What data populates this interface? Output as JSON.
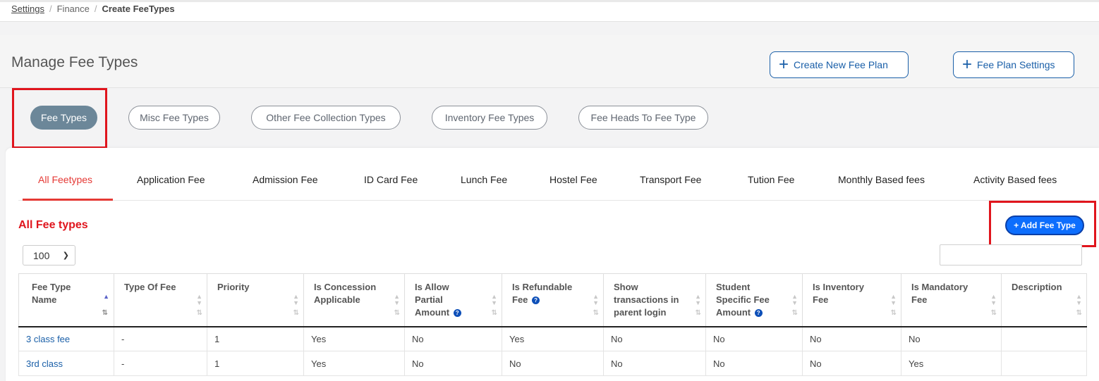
{
  "breadcrumb": {
    "link": "Settings",
    "middle": "Finance",
    "current": "Create FeeTypes"
  },
  "page_title": "Manage Fee Types",
  "header_buttons": {
    "create_plan": "Create New Fee Plan",
    "plan_settings": "Fee Plan Settings"
  },
  "pills": [
    "Fee Types",
    "Misc Fee Types",
    "Other Fee Collection Types",
    "Inventory Fee Types",
    "Fee Heads To Fee Type"
  ],
  "tabs": [
    "All Feetypes",
    "Application Fee",
    "Admission Fee",
    "ID Card Fee",
    "Lunch Fee",
    "Hostel Fee",
    "Transport Fee",
    "Tution Fee",
    "Monthly Based fees",
    "Activity Based fees"
  ],
  "section_title": "All Fee types",
  "add_button": "+ Add Fee Type",
  "page_size": "100",
  "search": {
    "value": "",
    "placeholder": ""
  },
  "table": {
    "headers": [
      {
        "l1": "Fee Type",
        "l2": "Name",
        "l3": ""
      },
      {
        "l1": "Type Of Fee",
        "l2": "",
        "l3": ""
      },
      {
        "l1": "Priority",
        "l2": "",
        "l3": ""
      },
      {
        "l1": "Is Concession",
        "l2": "Applicable",
        "l3": ""
      },
      {
        "l1": "Is Allow",
        "l2": "Partial",
        "l3": "Amount"
      },
      {
        "l1": "Is Refundable",
        "l2": "Fee",
        "l3": ""
      },
      {
        "l1": "Show",
        "l2": "transactions in",
        "l3": "parent login"
      },
      {
        "l1": "Student",
        "l2": "Specific Fee",
        "l3": "Amount"
      },
      {
        "l1": "Is Inventory",
        "l2": "Fee",
        "l3": ""
      },
      {
        "l1": "Is Mandatory",
        "l2": "Fee",
        "l3": ""
      },
      {
        "l1": "Description",
        "l2": "",
        "l3": ""
      }
    ],
    "rows": [
      [
        "3 class fee",
        "-",
        "1",
        "Yes",
        "No",
        "Yes",
        "No",
        "No",
        "No",
        "No",
        ""
      ],
      [
        "3rd class",
        "-",
        "1",
        "Yes",
        "No",
        "No",
        "No",
        "No",
        "No",
        "Yes",
        ""
      ]
    ]
  },
  "colors": {
    "accent_red": "#e0151d",
    "primary_blue": "#0d6efd",
    "link_blue": "#1a5fa8",
    "pill_active": "#6c8799"
  }
}
